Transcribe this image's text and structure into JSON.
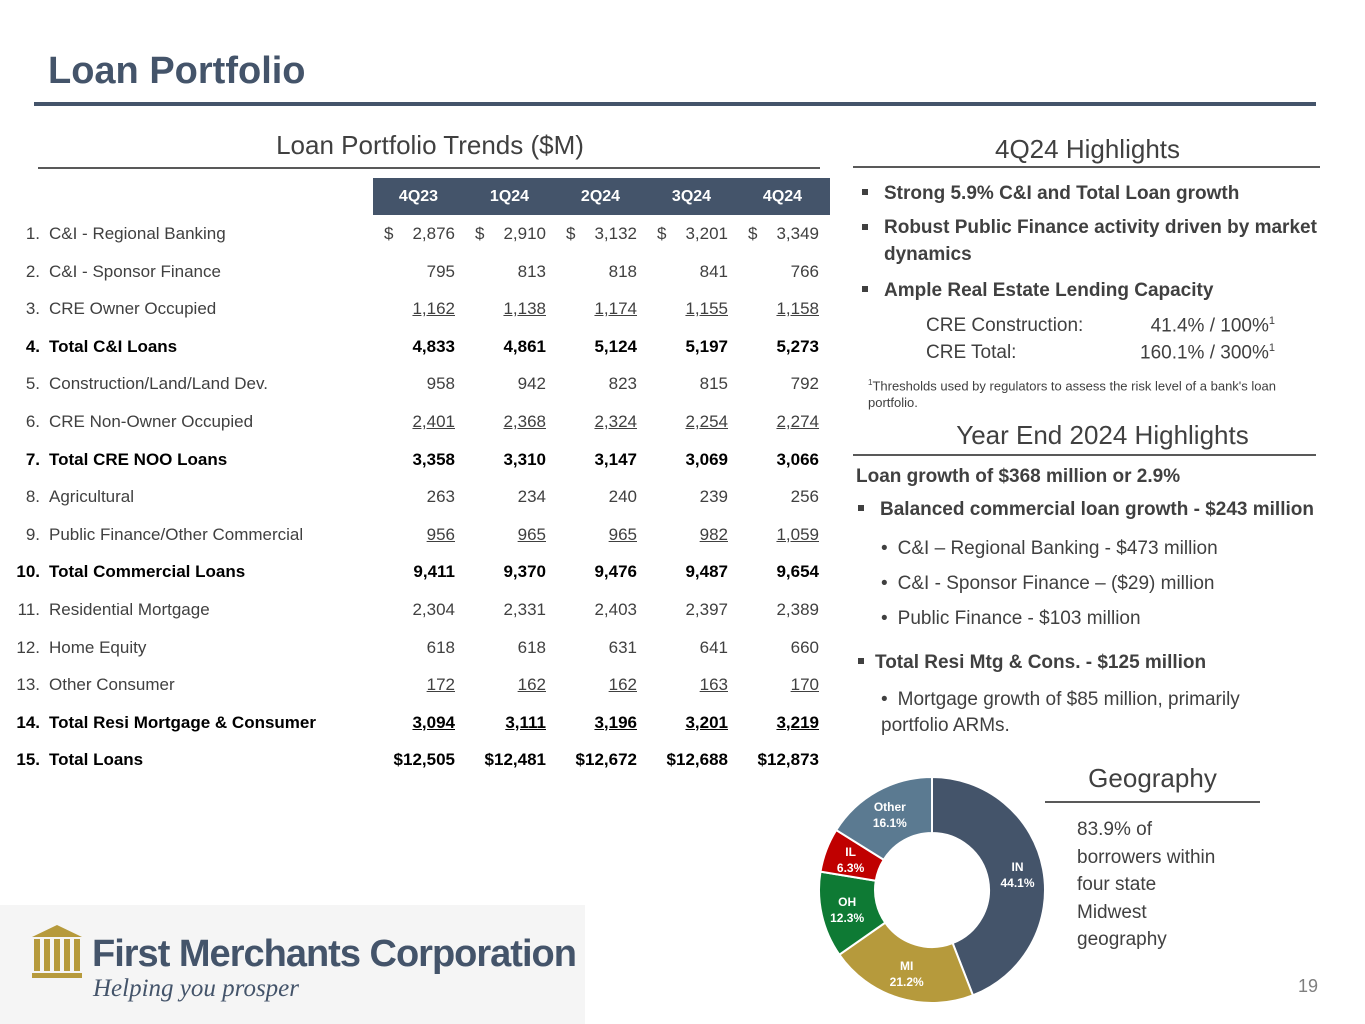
{
  "page": {
    "title": "Loan Portfolio",
    "page_number": "19"
  },
  "table": {
    "section_title": "Loan Portfolio Trends ($M)",
    "columns": [
      "4Q23",
      "1Q24",
      "2Q24",
      "3Q24",
      "4Q24"
    ],
    "rows": [
      {
        "num": "1.",
        "label": "C&I - Regional Banking",
        "values": [
          "2,876",
          "2,910",
          "3,132",
          "3,201",
          "3,349"
        ],
        "bold": false,
        "underline": false,
        "dollar": true
      },
      {
        "num": "2.",
        "label": "C&I - Sponsor Finance",
        "values": [
          "795",
          "813",
          "818",
          "841",
          "766"
        ],
        "bold": false,
        "underline": false,
        "dollar": false
      },
      {
        "num": "3.",
        "label": "CRE Owner Occupied",
        "values": [
          "1,162",
          "1,138",
          "1,174",
          "1,155",
          "1,158"
        ],
        "bold": false,
        "underline": true,
        "dollar": false
      },
      {
        "num": "4.",
        "label": "Total C&I Loans",
        "values": [
          "4,833",
          "4,861",
          "5,124",
          "5,197",
          "5,273"
        ],
        "bold": true,
        "underline": false,
        "dollar": false
      },
      {
        "num": "5.",
        "label": "Construction/Land/Land Dev.",
        "values": [
          "958",
          "942",
          "823",
          "815",
          "792"
        ],
        "bold": false,
        "underline": false,
        "dollar": false
      },
      {
        "num": "6.",
        "label": "CRE Non-Owner Occupied",
        "values": [
          "2,401",
          "2,368",
          "2,324",
          "2,254",
          "2,274"
        ],
        "bold": false,
        "underline": true,
        "dollar": false
      },
      {
        "num": "7.",
        "label": "Total CRE NOO Loans",
        "values": [
          "3,358",
          "3,310",
          "3,147",
          "3,069",
          "3,066"
        ],
        "bold": true,
        "underline": false,
        "dollar": false
      },
      {
        "num": "8.",
        "label": "Agricultural",
        "values": [
          "263",
          "234",
          "240",
          "239",
          "256"
        ],
        "bold": false,
        "underline": false,
        "dollar": false
      },
      {
        "num": "9.",
        "label": "Public Finance/Other Commercial",
        "values": [
          "956",
          "965",
          "965",
          "982",
          "1,059"
        ],
        "bold": false,
        "underline": true,
        "dollar": false
      },
      {
        "num": "10.",
        "label": "Total Commercial Loans",
        "values": [
          "9,411",
          "9,370",
          "9,476",
          "9,487",
          "9,654"
        ],
        "bold": true,
        "underline": false,
        "dollar": false
      },
      {
        "num": "11.",
        "label": "Residential Mortgage",
        "values": [
          "2,304",
          "2,331",
          "2,403",
          "2,397",
          "2,389"
        ],
        "bold": false,
        "underline": false,
        "dollar": false
      },
      {
        "num": "12.",
        "label": "Home Equity",
        "values": [
          "618",
          "618",
          "631",
          "641",
          "660"
        ],
        "bold": false,
        "underline": false,
        "dollar": false
      },
      {
        "num": "13.",
        "label": "Other Consumer",
        "values": [
          "172",
          "162",
          "162",
          "163",
          "170"
        ],
        "bold": false,
        "underline": true,
        "dollar": false
      },
      {
        "num": "14.",
        "label": "Total Resi Mortgage & Consumer",
        "values": [
          "3,094",
          "3,111",
          "3,196",
          "3,201",
          "3,219"
        ],
        "bold": true,
        "underline": true,
        "dollar": false
      },
      {
        "num": "15.",
        "label": "Total Loans",
        "values": [
          "$12,505",
          "$12,481",
          "$12,672",
          "$12,688",
          "$12,873"
        ],
        "bold": true,
        "underline": false,
        "dollar": false
      }
    ]
  },
  "highlights_4q": {
    "section_title": "4Q24 Highlights",
    "bullets": [
      "Strong 5.9% C&I and Total Loan growth",
      "Robust Public Finance activity driven by market dynamics",
      "Ample Real Estate Lending Capacity"
    ],
    "capacity": [
      {
        "label": "CRE Construction:",
        "value": "41.4% / 100%",
        "sup": "1"
      },
      {
        "label": "CRE Total:",
        "value": "160.1% / 300%",
        "sup": "1"
      }
    ],
    "footnote_sup": "1",
    "footnote": "Thresholds used by regulators to assess the risk level of a bank's loan portfolio."
  },
  "highlights_ye": {
    "section_title": "Year End 2024 Highlights",
    "lead": "Loan growth of $368 million or 2.9%",
    "bullet1": "Balanced commercial loan growth - $243 million",
    "sub1": [
      "C&I – Regional Banking - $473 million",
      "C&I - Sponsor Finance – ($29) million",
      "Public Finance - $103 million"
    ],
    "bullet2": "Total Resi Mtg & Cons. - $125 million",
    "sub2": "Mortgage growth of $85 million, primarily portfolio ARMs."
  },
  "geography": {
    "section_title": "Geography",
    "note": "83.9% of borrowers within four state Midwest geography"
  },
  "chart_data": {
    "type": "pie",
    "donut": true,
    "slices": [
      {
        "label": "IN",
        "value": 44.1,
        "display": "44.1%",
        "color": "#44546a"
      },
      {
        "label": "MI",
        "value": 21.2,
        "display": "21.2%",
        "color": "#b69a3c"
      },
      {
        "label": "OH",
        "value": 12.3,
        "display": "12.3%",
        "color": "#0e7a34"
      },
      {
        "label": "IL",
        "value": 6.3,
        "display": "6.3%",
        "color": "#c00000"
      },
      {
        "label": "Other",
        "value": 16.1,
        "display": "16.1%",
        "color": "#5b7a91"
      }
    ]
  },
  "logo": {
    "name": "First Merchants Corporation",
    "tagline": "Helping you prosper",
    "color": "#b69a3c"
  }
}
